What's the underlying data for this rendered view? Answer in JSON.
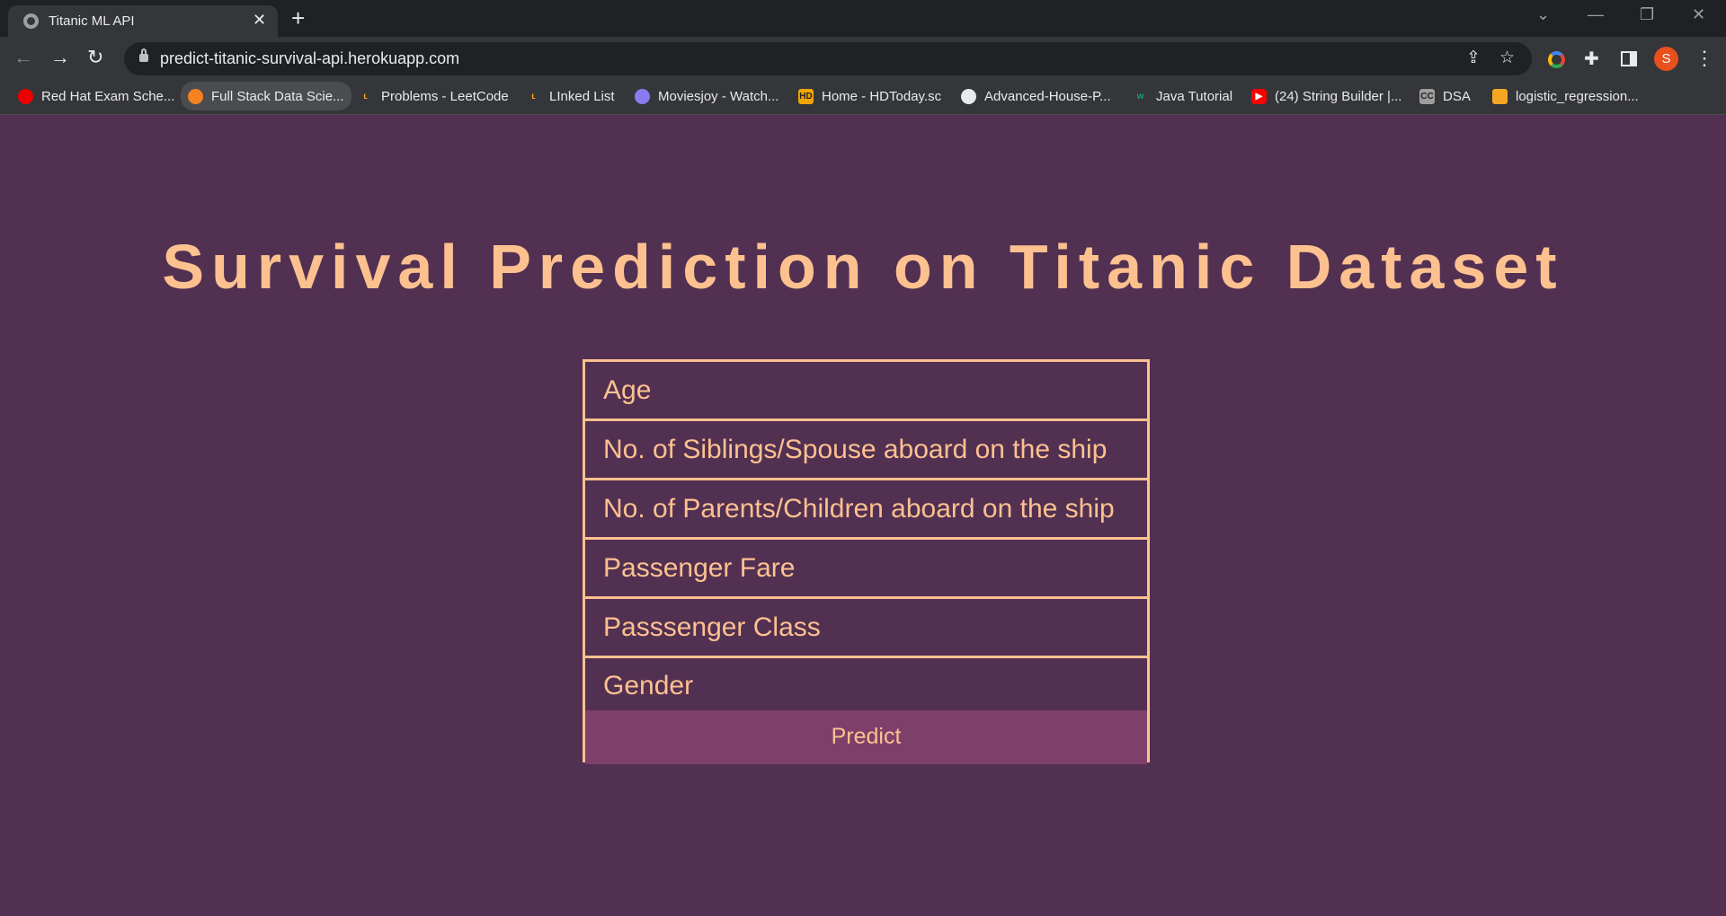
{
  "browser": {
    "tab_title": "Titanic ML API",
    "new_tab_symbol": "+",
    "url": "predict-titanic-survival-api.herokuapp.com",
    "profile_initial": "S",
    "bookmarks": [
      {
        "label": "Red Hat Exam Sche...",
        "icon": "redhat-icon",
        "color": "#ee0000"
      },
      {
        "label": "Full Stack Data Scie...",
        "icon": "orange-circle-icon",
        "color": "#f5821f"
      },
      {
        "label": "Problems - LeetCode",
        "icon": "leetcode-icon",
        "color": "#ffa116"
      },
      {
        "label": "LInked List",
        "icon": "leetcode-icon",
        "color": "#ffa116"
      },
      {
        "label": "Moviesjoy - Watch...",
        "icon": "moviesjoy-icon",
        "color": "#8a7cf0"
      },
      {
        "label": "Home - HDToday.sc",
        "icon": "hd-icon",
        "color": "#f0a500"
      },
      {
        "label": "Advanced-House-P...",
        "icon": "github-icon",
        "color": "#e8eaed"
      },
      {
        "label": "Java Tutorial",
        "icon": "w3schools-icon",
        "color": "#04aa6d"
      },
      {
        "label": "(24) String Builder |...",
        "icon": "youtube-icon",
        "color": "#ff0000"
      },
      {
        "label": "DSA",
        "icon": "cc-icon",
        "color": "#9e9e9e"
      },
      {
        "label": "logistic_regression...",
        "icon": "notebook-icon",
        "color": "#f5a623"
      }
    ]
  },
  "page": {
    "title": "Survival Prediction on Titanic Dataset",
    "fields": {
      "age": "Age",
      "siblings": "No. of Siblings/Spouse aboard on the ship",
      "parents": "No. of Parents/Children aboard on the ship",
      "fare": "Passenger Fare",
      "pclass": "Passsenger Class",
      "gender": "Gender"
    },
    "predict_label": "Predict",
    "colors": {
      "background": "#523052",
      "accent": "#fdc190",
      "button": "#7e3f6b"
    }
  }
}
